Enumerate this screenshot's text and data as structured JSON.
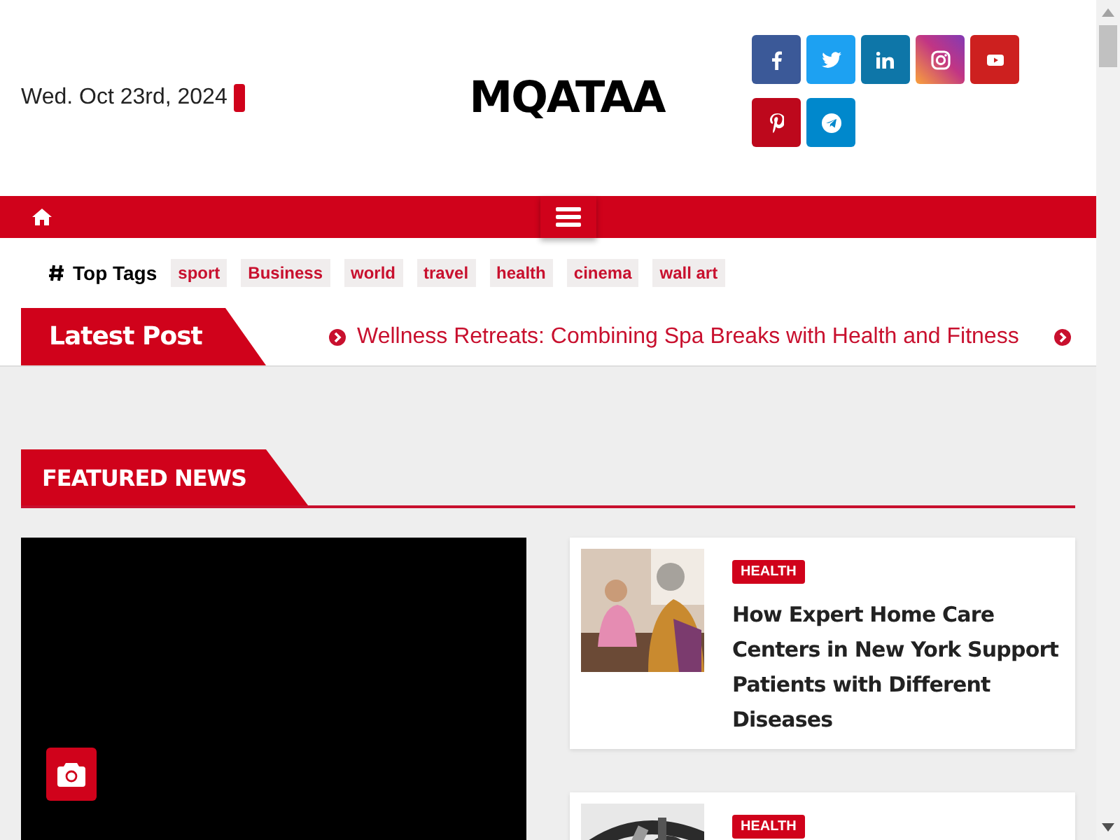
{
  "header": {
    "date": "Wed. Oct 23rd, 2024",
    "logo": "MQATAA",
    "social": [
      {
        "kind": "facebook",
        "color": "#3b5998"
      },
      {
        "kind": "twitter",
        "color": "#1da1f2"
      },
      {
        "kind": "linkedin",
        "color": "#0e76a8"
      },
      {
        "kind": "instagram",
        "color": "#c13584"
      },
      {
        "kind": "youtube",
        "color": "#cd201f"
      },
      {
        "kind": "pinterest",
        "color": "#bd081c"
      },
      {
        "kind": "telegram",
        "color": "#0088cc"
      }
    ]
  },
  "top_tags": {
    "label": "Top Tags",
    "tags": [
      "sport",
      "Business",
      "world",
      "travel",
      "health",
      "cinema",
      "wall art"
    ]
  },
  "latest_post": {
    "label": "Latest Post",
    "headline": "Wellness Retreats: Combining Spa Breaks with Health and Fitness"
  },
  "featured": {
    "heading": "FEATURED NEWS",
    "posts": [
      {
        "category": "HEALTH",
        "title": "How Expert Home Care Centers in New York Support Patients with Different Diseases"
      },
      {
        "category": "HEALTH"
      }
    ]
  }
}
